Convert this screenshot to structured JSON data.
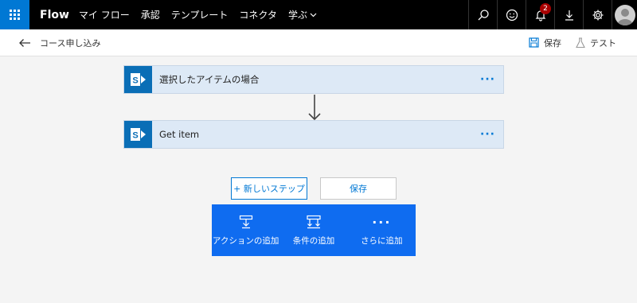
{
  "nav": {
    "brand": "Flow",
    "items": [
      "マイ フロー",
      "承認",
      "テンプレート",
      "コネクタ",
      "学ぶ"
    ],
    "notification_count": "2"
  },
  "cmdbar": {
    "flow_name": "コース申し込み",
    "save_label": "保存",
    "test_label": "テスト"
  },
  "steps": [
    {
      "title": "選択したアイテムの場合",
      "more": "···"
    },
    {
      "title": "Get item",
      "more": "···"
    }
  ],
  "actions": {
    "new_step_label": "+ 新しいステップ",
    "save_label": "保存"
  },
  "step_menu": {
    "items": [
      "アクションの追加",
      "条件の追加",
      "さらに追加"
    ],
    "more_glyph": "···"
  },
  "colors": {
    "accent": "#0078d4",
    "menu_bg": "#0f6cf0",
    "card_bg": "#dde9f6",
    "sharepoint": "#0a6eb6",
    "badge": "#a80000"
  }
}
